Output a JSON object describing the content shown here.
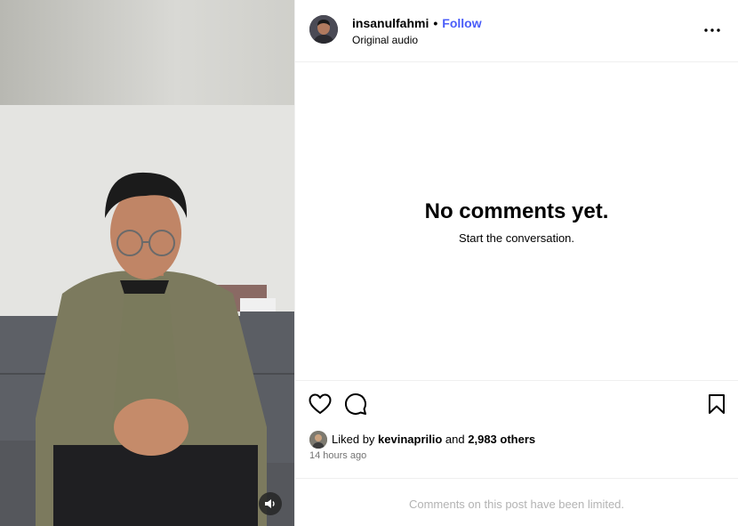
{
  "post": {
    "username": "insanulfahmi",
    "separator": "•",
    "follow_label": "Follow",
    "audio_label": "Original audio"
  },
  "comments": {
    "empty_title": "No comments yet.",
    "empty_subtitle": "Start the conversation."
  },
  "likes": {
    "prefix": "Liked by",
    "first_liker": "kevinaprilio",
    "connector": "and",
    "others": "2,983 others",
    "timestamp": "14 hours ago"
  },
  "footer": {
    "limited_text": "Comments on this post have been limited."
  },
  "icons": {
    "more": "more-options-icon",
    "like": "heart-icon",
    "comment": "comment-bubble-icon",
    "save": "bookmark-icon",
    "audio": "speaker-icon"
  },
  "colors": {
    "follow": "#4a5df9",
    "muted_text": "#737373",
    "limited_text": "#b3b3b3"
  }
}
